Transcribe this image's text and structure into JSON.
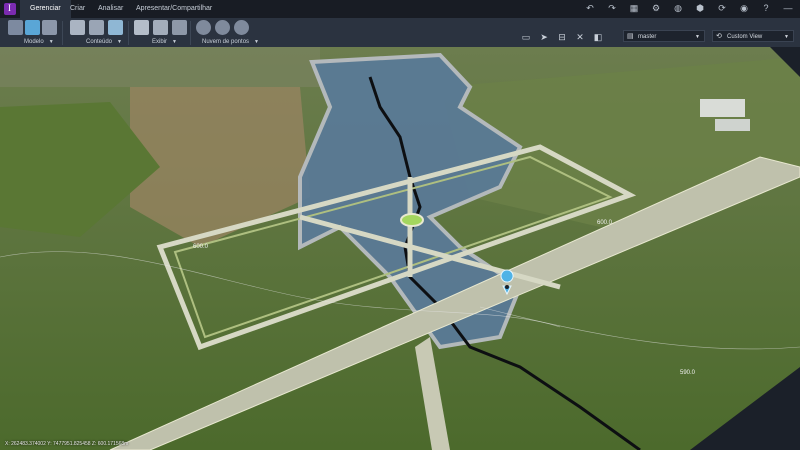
{
  "app": {
    "logo_icon": "infraworks-logo-icon"
  },
  "tabs": [
    {
      "label": "Gerenciar",
      "active": true
    },
    {
      "label": "Criar",
      "active": false
    },
    {
      "label": "Analisar",
      "active": false
    },
    {
      "label": "Apresentar/Compartilhar",
      "active": false
    }
  ],
  "title_icons": [
    "undo-icon",
    "redo-icon",
    "grid-icon",
    "settings-icon",
    "globe-icon",
    "cube-icon",
    "sync-icon",
    "user-icon",
    "help-icon",
    "minimize-icon"
  ],
  "ribbon": {
    "groups": [
      {
        "label": "Modelo",
        "icons": [
          "model-icon",
          "frame-icon",
          "data-icon"
        ]
      },
      {
        "label": "Conteúdo",
        "icons": [
          "database-icon",
          "stack-icon",
          "globe-layers-icon"
        ]
      },
      {
        "label": "Exibir",
        "icons": [
          "layers-icon",
          "terrain-icon",
          "table-icon"
        ]
      },
      {
        "label": "Nuvem de pontos",
        "icons": [
          "pointcloud-icon",
          "pointcloud-terrain-icon",
          "pointcloud-cut-icon"
        ]
      }
    ],
    "tools": [
      "presentation-icon",
      "select-cursor-icon",
      "measure-icon",
      "tools-icon",
      "tag-icon"
    ]
  },
  "proposal_dropdown": {
    "value": "master",
    "icon": "proposal-icon"
  },
  "view_dropdown": {
    "value": "Custom View",
    "icon": "view-icon"
  },
  "viewport": {
    "contour_labels": [
      "600.0",
      "600.0",
      "590.0"
    ],
    "pin_icon": "location-pin-icon"
  },
  "status": {
    "coordinates": "X: 262483.374002  Y: 7477951.825458  Z: 600.171568m"
  },
  "colors": {
    "ribbon_bg": "#2b3340",
    "titlebar_bg": "#181c24",
    "water": "#5a7a96",
    "terrain": "#5c7a3a",
    "road": "#c8c9b4",
    "roundabout": "#a4d65e",
    "pin": "#4fb3e6"
  }
}
